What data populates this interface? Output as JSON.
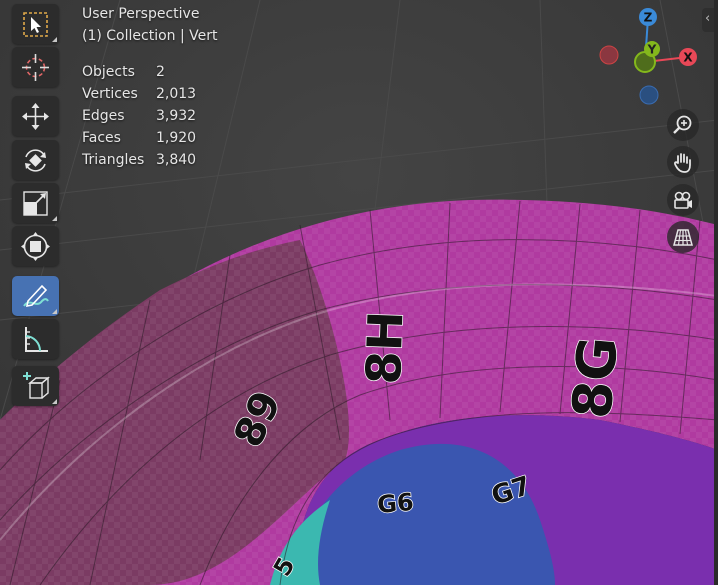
{
  "viewport": {
    "view_name": "User Perspective",
    "collection_line": "(1) Collection | Vert"
  },
  "stats": [
    {
      "label": "Objects",
      "value": "2"
    },
    {
      "label": "Vertices",
      "value": "2,013"
    },
    {
      "label": "Edges",
      "value": "3,932"
    },
    {
      "label": "Faces",
      "value": "1,920"
    },
    {
      "label": "Triangles",
      "value": "3,840"
    }
  ],
  "toolbar": [
    {
      "name": "select-box-tool",
      "icon": "select-box-icon",
      "active": false
    },
    {
      "name": "cursor-tool",
      "icon": "cursor-icon",
      "active": false
    },
    {
      "name": "move-tool",
      "icon": "move-icon",
      "active": false
    },
    {
      "name": "rotate-tool",
      "icon": "rotate-icon",
      "active": false
    },
    {
      "name": "scale-tool",
      "icon": "scale-icon",
      "active": false
    },
    {
      "name": "transform-tool",
      "icon": "transform-icon",
      "active": false
    },
    {
      "name": "annotate-tool",
      "icon": "annotate-icon",
      "active": true
    },
    {
      "name": "measure-tool",
      "icon": "measure-icon",
      "active": false
    },
    {
      "name": "add-cube-tool",
      "icon": "add-cube-icon",
      "active": false
    }
  ],
  "gizmo": {
    "x": "X",
    "y": "Y",
    "z": "Z"
  },
  "nav_buttons": [
    "zoom-icon",
    "hand-pan-icon",
    "camera-icon",
    "perspective-grid-icon"
  ],
  "scene_labels": [
    "8H",
    "8G",
    "89",
    "G7",
    "G6",
    "5"
  ],
  "colors": {
    "background": "#3c3c3c",
    "active_tool": "#4772b3",
    "mesh_magenta": "#b03aa0",
    "mesh_dark_magenta": "#7a3a60",
    "mesh_blue": "#3a56b0",
    "mesh_teal": "#3bb8b0",
    "axis_x": "#e84857",
    "axis_y": "#84b81c",
    "axis_z": "#3a8ad8"
  }
}
